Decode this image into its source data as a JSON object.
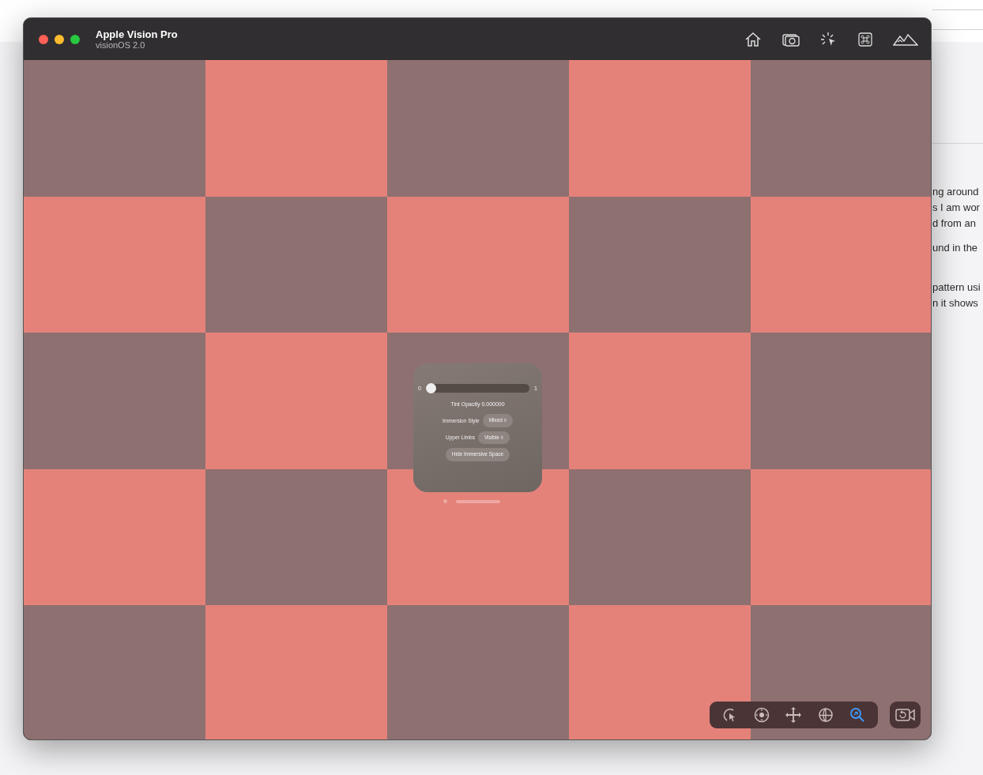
{
  "background_page": {
    "text_lines": [
      "ng around",
      "s I am wor",
      "d from an",
      "und in the",
      "pattern usi",
      "n it shows"
    ]
  },
  "window": {
    "title": "Apple Vision Pro",
    "subtitle": "visionOS 2.0"
  },
  "panel": {
    "slider": {
      "min_label": "0",
      "max_label": "1",
      "level": 0
    },
    "tint_label": "Tint Opacity 0.000000",
    "settings": [
      {
        "label": "Immersion Style",
        "value": "Mixed ◊"
      },
      {
        "label": "Upper Limbs",
        "value": "Visible ◊"
      }
    ],
    "button": "Hide Immersive Space"
  },
  "tools": [
    {
      "kind": "interact",
      "selected": false
    },
    {
      "kind": "drag",
      "selected": false
    },
    {
      "kind": "move",
      "selected": false
    },
    {
      "kind": "orbit",
      "selected": false
    },
    {
      "kind": "zoom",
      "selected": true
    }
  ]
}
